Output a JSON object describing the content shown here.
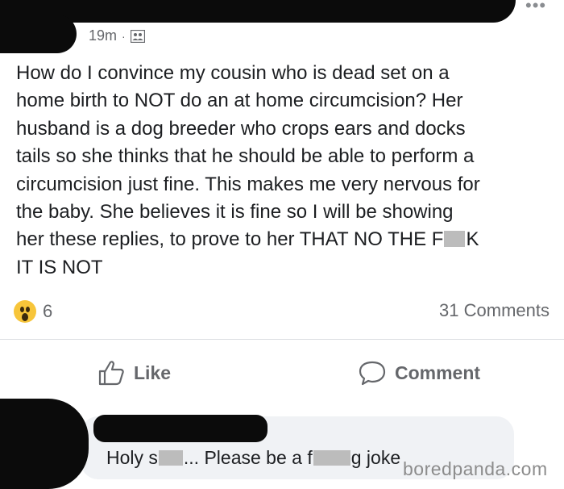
{
  "post": {
    "time": "19m",
    "separator": "·",
    "audience_icon": "friends-icon",
    "more_icon": "more-dots-icon",
    "more_label": "•••",
    "text_lines": [
      "How do I convince my cousin who is dead set on a",
      "home birth to NOT do an at home circumcision? Her",
      "husband is a dog breeder who crops ears and docks",
      "tails so she thinks that he should be able to perform a",
      "circumcision just fine. This makes me very nervous for",
      "the baby. She believes it is fine so I will be showing",
      "her these replies, to prove to her THAT NO THE F",
      "K",
      "IT IS NOT"
    ]
  },
  "engagement": {
    "reaction_icon": "wow-reaction-icon",
    "reaction_count": "6",
    "comments_count": "31 Comments"
  },
  "actions": {
    "like_label": "Like",
    "comment_label": "Comment"
  },
  "comment": {
    "text_part1": "Holy s",
    "text_part2": "... Please be a f",
    "text_part3": "g joke"
  },
  "watermark": "boredpanda.com",
  "colors": {
    "text": "#1c1e21",
    "secondary": "#65676b",
    "bubble": "#f0f2f5",
    "wow": "#f7c53a"
  }
}
